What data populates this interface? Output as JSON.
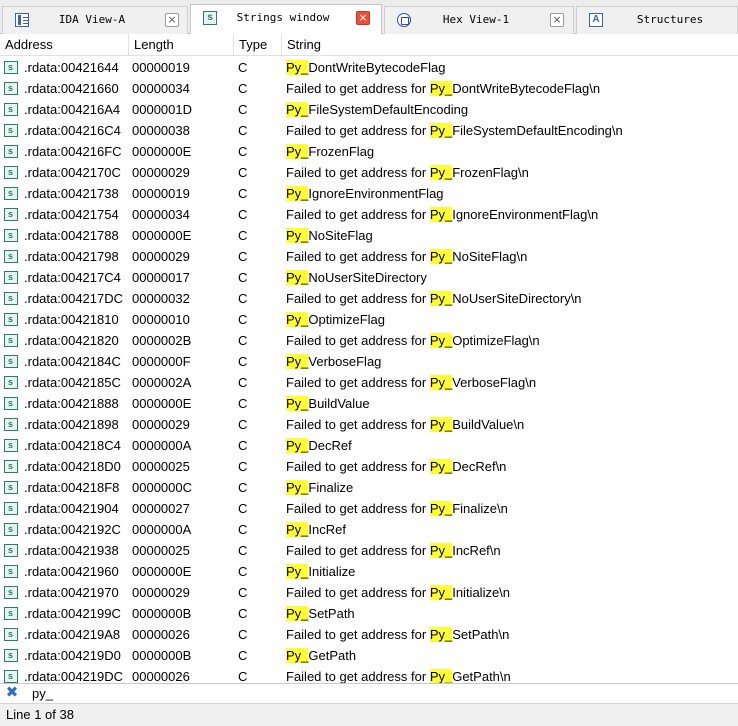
{
  "tabs": [
    {
      "label": "IDA View-A",
      "icon": "ida-view-icon",
      "close": "gray",
      "active": false
    },
    {
      "label": "Strings window",
      "icon": "strings-icon",
      "close": "red",
      "active": true
    },
    {
      "label": "Hex View-1",
      "icon": "hex-view-icon",
      "close": "gray",
      "active": false
    },
    {
      "label": "Structures",
      "icon": "structures-icon",
      "close": "none",
      "active": false
    }
  ],
  "close_glyph": "×",
  "strings_icon_glyph": "s",
  "structures_icon_glyph": "A",
  "columns": {
    "address": "Address",
    "length": "Length",
    "type": "Type",
    "string": "String"
  },
  "highlight_color": "#ffff33",
  "rows": [
    {
      "addr": ".rdata:00421644",
      "len": "00000019",
      "type": "C",
      "pre": "",
      "hl": "Py_",
      "post": "DontWriteBytecodeFlag"
    },
    {
      "addr": ".rdata:00421660",
      "len": "00000034",
      "type": "C",
      "pre": "Failed to get address for ",
      "hl": "Py_",
      "post": "DontWriteBytecodeFlag\\n"
    },
    {
      "addr": ".rdata:004216A4",
      "len": "0000001D",
      "type": "C",
      "pre": "",
      "hl": "Py_",
      "post": "FileSystemDefaultEncoding"
    },
    {
      "addr": ".rdata:004216C4",
      "len": "00000038",
      "type": "C",
      "pre": "Failed to get address for ",
      "hl": "Py_",
      "post": "FileSystemDefaultEncoding\\n"
    },
    {
      "addr": ".rdata:004216FC",
      "len": "0000000E",
      "type": "C",
      "pre": "",
      "hl": "Py_",
      "post": "FrozenFlag"
    },
    {
      "addr": ".rdata:0042170C",
      "len": "00000029",
      "type": "C",
      "pre": "Failed to get address for ",
      "hl": "Py_",
      "post": "FrozenFlag\\n"
    },
    {
      "addr": ".rdata:00421738",
      "len": "00000019",
      "type": "C",
      "pre": "",
      "hl": "Py_",
      "post": "IgnoreEnvironmentFlag"
    },
    {
      "addr": ".rdata:00421754",
      "len": "00000034",
      "type": "C",
      "pre": "Failed to get address for ",
      "hl": "Py_",
      "post": "IgnoreEnvironmentFlag\\n"
    },
    {
      "addr": ".rdata:00421788",
      "len": "0000000E",
      "type": "C",
      "pre": "",
      "hl": "Py_",
      "post": "NoSiteFlag"
    },
    {
      "addr": ".rdata:00421798",
      "len": "00000029",
      "type": "C",
      "pre": "Failed to get address for ",
      "hl": "Py_",
      "post": "NoSiteFlag\\n"
    },
    {
      "addr": ".rdata:004217C4",
      "len": "00000017",
      "type": "C",
      "pre": "",
      "hl": "Py_",
      "post": "NoUserSiteDirectory"
    },
    {
      "addr": ".rdata:004217DC",
      "len": "00000032",
      "type": "C",
      "pre": "Failed to get address for ",
      "hl": "Py_",
      "post": "NoUserSiteDirectory\\n"
    },
    {
      "addr": ".rdata:00421810",
      "len": "00000010",
      "type": "C",
      "pre": "",
      "hl": "Py_",
      "post": "OptimizeFlag"
    },
    {
      "addr": ".rdata:00421820",
      "len": "0000002B",
      "type": "C",
      "pre": "Failed to get address for ",
      "hl": "Py_",
      "post": "OptimizeFlag\\n"
    },
    {
      "addr": ".rdata:0042184C",
      "len": "0000000F",
      "type": "C",
      "pre": "",
      "hl": "Py_",
      "post": "VerboseFlag"
    },
    {
      "addr": ".rdata:0042185C",
      "len": "0000002A",
      "type": "C",
      "pre": "Failed to get address for ",
      "hl": "Py_",
      "post": "VerboseFlag\\n"
    },
    {
      "addr": ".rdata:00421888",
      "len": "0000000E",
      "type": "C",
      "pre": "",
      "hl": "Py_",
      "post": "BuildValue"
    },
    {
      "addr": ".rdata:00421898",
      "len": "00000029",
      "type": "C",
      "pre": "Failed to get address for ",
      "hl": "Py_",
      "post": "BuildValue\\n"
    },
    {
      "addr": ".rdata:004218C4",
      "len": "0000000A",
      "type": "C",
      "pre": "",
      "hl": "Py_",
      "post": "DecRef"
    },
    {
      "addr": ".rdata:004218D0",
      "len": "00000025",
      "type": "C",
      "pre": "Failed to get address for ",
      "hl": "Py_",
      "post": "DecRef\\n"
    },
    {
      "addr": ".rdata:004218F8",
      "len": "0000000C",
      "type": "C",
      "pre": "",
      "hl": "Py_",
      "post": "Finalize"
    },
    {
      "addr": ".rdata:00421904",
      "len": "00000027",
      "type": "C",
      "pre": "Failed to get address for ",
      "hl": "Py_",
      "post": "Finalize\\n"
    },
    {
      "addr": ".rdata:0042192C",
      "len": "0000000A",
      "type": "C",
      "pre": "",
      "hl": "Py_",
      "post": "IncRef"
    },
    {
      "addr": ".rdata:00421938",
      "len": "00000025",
      "type": "C",
      "pre": "Failed to get address for ",
      "hl": "Py_",
      "post": "IncRef\\n"
    },
    {
      "addr": ".rdata:00421960",
      "len": "0000000E",
      "type": "C",
      "pre": "",
      "hl": "Py_",
      "post": "Initialize"
    },
    {
      "addr": ".rdata:00421970",
      "len": "00000029",
      "type": "C",
      "pre": "Failed to get address for ",
      "hl": "Py_",
      "post": "Initialize\\n"
    },
    {
      "addr": ".rdata:0042199C",
      "len": "0000000B",
      "type": "C",
      "pre": "",
      "hl": "Py_",
      "post": "SetPath"
    },
    {
      "addr": ".rdata:004219A8",
      "len": "00000026",
      "type": "C",
      "pre": "Failed to get address for ",
      "hl": "Py_",
      "post": "SetPath\\n"
    },
    {
      "addr": ".rdata:004219D0",
      "len": "0000000B",
      "type": "C",
      "pre": "",
      "hl": "Py_",
      "post": "GetPath"
    },
    {
      "addr": ".rdata:004219DC",
      "len": "00000026",
      "type": "C",
      "pre": "Failed to get address for ",
      "hl": "Py_",
      "post": "GetPath\\n"
    }
  ],
  "filter": {
    "value": "py_",
    "clear_glyph": "✖"
  },
  "status": {
    "text": "Line 1 of 38"
  }
}
